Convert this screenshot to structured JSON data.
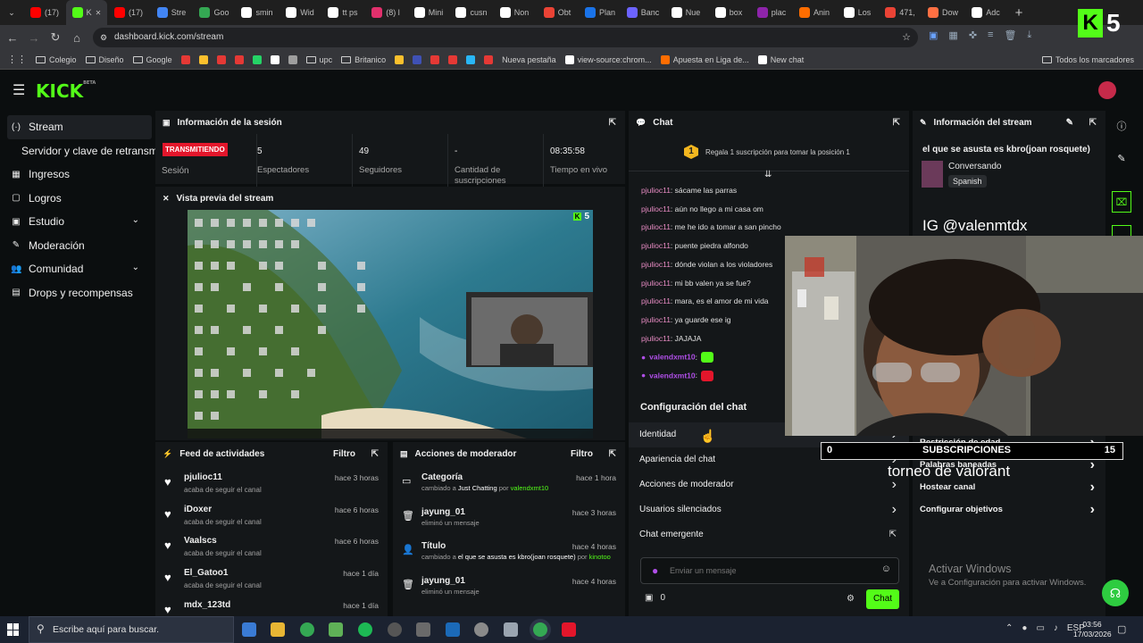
{
  "browser": {
    "tabs": [
      {
        "label": "(17)",
        "color": "#ff0000"
      },
      {
        "label": "K",
        "color": "#53fc18",
        "active": true
      },
      {
        "label": "(17)",
        "color": "#ff0000"
      },
      {
        "label": "Stre",
        "color": "#4285f4"
      },
      {
        "label": "Goo",
        "color": "#34a853"
      },
      {
        "label": "smin",
        "color": "#ffffff"
      },
      {
        "label": "Wid",
        "color": "#ffffff"
      },
      {
        "label": "tt ps",
        "color": "#ffffff"
      },
      {
        "label": "(8) l",
        "color": "#e1306c"
      },
      {
        "label": "Mini",
        "color": "#ffffff"
      },
      {
        "label": "cusn",
        "color": "#ffffff"
      },
      {
        "label": "Non",
        "color": "#ffffff"
      },
      {
        "label": "Obt",
        "color": "#ea4335"
      },
      {
        "label": "Plan",
        "color": "#1a73e8"
      },
      {
        "label": "Banc",
        "color": "#6c63ff"
      },
      {
        "label": "Nue",
        "color": "#ffffff"
      },
      {
        "label": "box",
        "color": "#ffffff"
      },
      {
        "label": "plac",
        "color": "#8e24aa"
      },
      {
        "label": "Anin",
        "color": "#ff6d00"
      },
      {
        "label": "Los",
        "color": "#ffffff"
      },
      {
        "label": "471,",
        "color": "#ea4335"
      },
      {
        "label": "Dow",
        "color": "#ff7043"
      },
      {
        "label": "Adc",
        "color": "#ffffff"
      }
    ],
    "new_tab": "+",
    "url": "dashboard.kick.com/stream",
    "bookmarks": [
      {
        "label": "Colegio",
        "type": "folder"
      },
      {
        "label": "Diseño",
        "type": "folder"
      },
      {
        "label": "Google",
        "type": "folder"
      },
      {
        "label": "",
        "type": "icon",
        "color": "#e53935"
      },
      {
        "label": "",
        "type": "icon",
        "color": "#fbc02d"
      },
      {
        "label": "",
        "type": "icon",
        "color": "#e53935"
      },
      {
        "label": "",
        "type": "icon",
        "color": "#e53935"
      },
      {
        "label": "",
        "type": "icon",
        "color": "#25d366"
      },
      {
        "label": "",
        "type": "icon",
        "color": "#ffffff"
      },
      {
        "label": "",
        "type": "icon",
        "color": "#9e9e9e"
      },
      {
        "label": "upc",
        "type": "folder"
      },
      {
        "label": "Britanico",
        "type": "folder"
      },
      {
        "label": "",
        "type": "icon",
        "color": "#fbc02d"
      },
      {
        "label": "",
        "type": "icon",
        "color": "#3f51b5"
      },
      {
        "label": "",
        "type": "icon",
        "color": "#e53935"
      },
      {
        "label": "",
        "type": "icon",
        "color": "#e53935"
      },
      {
        "label": "",
        "type": "icon",
        "color": "#29b6f6"
      },
      {
        "label": "",
        "type": "icon",
        "color": "#e53935"
      },
      {
        "label": "Nueva pestaña",
        "type": "none"
      },
      {
        "label": "view-source:chrom...",
        "type": "icon",
        "color": "#ffffff"
      },
      {
        "label": "Apuesta en Liga de...",
        "type": "icon",
        "color": "#ff6d00"
      },
      {
        "label": "New chat",
        "type": "icon",
        "color": "#ffffff"
      }
    ],
    "all_bookmarks": "Todos los marcadores"
  },
  "brand": {
    "logo": "KICK",
    "beta": "BETA",
    "accent": "#53fc18"
  },
  "sidebar": {
    "items": [
      {
        "label": "Stream",
        "icon": "stream-icon",
        "glyph": "(·)",
        "active": true
      },
      {
        "label": "Servidor y clave de retransmi",
        "icon": "",
        "glyph": "",
        "sub": true
      },
      {
        "label": "Ingresos",
        "icon": "revenue-icon",
        "glyph": "▦"
      },
      {
        "label": "Logros",
        "icon": "achievements-icon",
        "glyph": "▢"
      },
      {
        "label": "Estudio",
        "icon": "studio-icon",
        "glyph": "▣",
        "chevron": true
      },
      {
        "label": "Moderación",
        "icon": "moderation-icon",
        "glyph": "✎"
      },
      {
        "label": "Comunidad",
        "icon": "community-icon",
        "glyph": "👥",
        "chevron": true
      },
      {
        "label": "Drops y recompensas",
        "icon": "drops-icon",
        "glyph": "▤"
      }
    ]
  },
  "session": {
    "title": "Información de la sesión",
    "live_badge": "TRANSMITIENDO",
    "session_label": "Sesión",
    "stats": [
      {
        "value": "5",
        "label": "Espectadores"
      },
      {
        "value": "49",
        "label": "Seguidores"
      },
      {
        "value": "-",
        "label": "Cantidad de suscripciones"
      },
      {
        "value": "08:35:58",
        "label": "Tiempo en vivo"
      }
    ]
  },
  "preview": {
    "title": "Vista previa del stream",
    "viewer_count": "5"
  },
  "activity": {
    "title": "Feed de actividades",
    "filter": "Filtro",
    "items": [
      {
        "name": "pjulioc11",
        "text": "acaba de seguir el canal",
        "time": "hace 3 horas"
      },
      {
        "name": "iDoxer",
        "text": "acaba de seguir el canal",
        "time": "hace 6 horas"
      },
      {
        "name": "Vaalscs",
        "text": "acaba de seguir el canal",
        "time": "hace 6 horas"
      },
      {
        "name": "El_Gatoo1",
        "text": "acaba de seguir el canal",
        "time": "hace 1 día"
      },
      {
        "name": "mdx_123td",
        "text": "",
        "time": "hace 1 día"
      }
    ]
  },
  "modactions": {
    "title": "Acciones de moderador",
    "filter": "Filtro",
    "items": [
      {
        "name": "Categoría",
        "pre": "cambiado a ",
        "hl": "Just Chatting",
        "mid": " por ",
        "user": "valendxmt10",
        "time": "hace 1 hora",
        "icon": "category-icon",
        "glyph": "▭"
      },
      {
        "name": "jayung_01",
        "pre": "eliminó un mensaje",
        "hl": "",
        "mid": "",
        "user": "",
        "time": "hace 3 horas",
        "icon": "trash-icon",
        "glyph": "🗑"
      },
      {
        "name": "Título",
        "pre": "cambiado a ",
        "hl": "el que se asusta es kbro(joan rosquete)",
        "mid": " por ",
        "user": "kinotoo",
        "time": "hace 4 horas",
        "icon": "user-edit-icon",
        "glyph": "👤"
      },
      {
        "name": "jayung_01",
        "pre": "eliminó un mensaje",
        "hl": "",
        "mid": "",
        "user": "",
        "time": "hace 4 horas",
        "icon": "trash-icon",
        "glyph": "🗑"
      }
    ]
  },
  "chat": {
    "title": "Chat",
    "pinned_rank": "1",
    "pinned_text": "Regala 1 suscripción para tomar la posición 1",
    "messages": [
      {
        "user": "pjulioc11",
        "text": "sácame las parras"
      },
      {
        "user": "pjulioc11",
        "text": "aún no llego a mi casa om"
      },
      {
        "user": "pjulioc11",
        "text": "me he ido a tomar a san pincho"
      },
      {
        "user": "pjulioc11",
        "text": "puente piedra alfondo"
      },
      {
        "user": "pjulioc11",
        "text": "dónde violan a los violadores"
      },
      {
        "user": "pjulioc11",
        "text": "mi bb valen ya se fue?"
      },
      {
        "user": "pjulioc11",
        "text": "mara, es el amor de mi vida"
      },
      {
        "user": "pjulioc11",
        "text": "ya guarde ese ig"
      },
      {
        "user": "pjulioc11",
        "text": "JAJAJA"
      },
      {
        "user": "valendxmt10",
        "text": "",
        "owner": true
      },
      {
        "user": "valendxmt10",
        "text": "",
        "owner": true
      }
    ],
    "config_title": "Configuración del chat",
    "config_items": [
      {
        "label": "Identidad",
        "icon": "chevron-right-icon"
      },
      {
        "label": "Apariencia del chat",
        "icon": "chevron-right-icon"
      },
      {
        "label": "Acciones de moderador",
        "icon": "chevron-right-icon"
      },
      {
        "label": "Usuarios silenciados",
        "icon": "chevron-right-icon"
      },
      {
        "label": "Chat emergente",
        "icon": "external-link-icon"
      }
    ],
    "input_placeholder": "Enviar un mensaje",
    "points": "0",
    "send_label": "Chat"
  },
  "streaminfo": {
    "title": "Información del stream",
    "stream_title": "el que se asusta es kbro(joan rosquete)",
    "category": "Conversando",
    "language": "Spanish",
    "items": [
      {
        "label": "Restricción de edad"
      },
      {
        "label": "Palabras baneadas"
      },
      {
        "label": "Hostear canal"
      },
      {
        "label": "Configurar objetivos"
      }
    ]
  },
  "overlay": {
    "ig_handle": "IG @valenmtdx",
    "sub_left": "0",
    "sub_label": "SUBSCRIPCIONES",
    "sub_right": "15",
    "tournament": "torneo de valorant",
    "kick_viewers": "5"
  },
  "windows": {
    "activate_title": "Activar Windows",
    "activate_sub": "Ve a Configuración para activar Windows.",
    "search_placeholder": "Escribe aquí para buscar.",
    "lang": "ESP",
    "time": "03:56",
    "date": "17/03/2026"
  }
}
